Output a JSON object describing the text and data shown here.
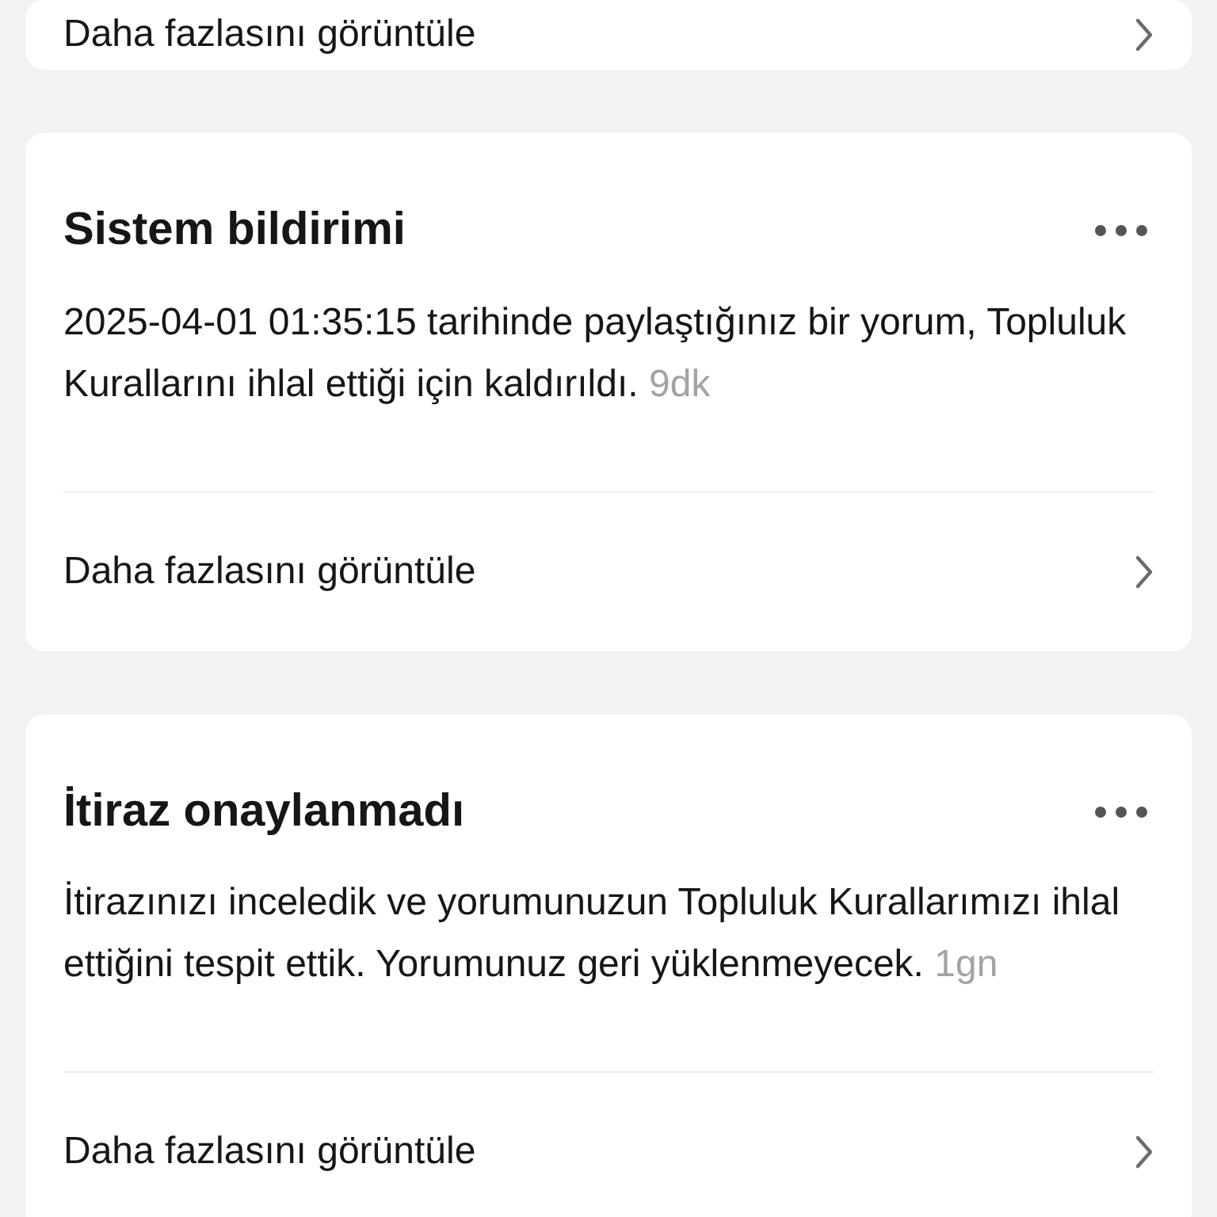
{
  "cards": [
    {
      "link": "Daha fazlasını görüntüle"
    },
    {
      "title": "Sistem bildirimi",
      "body": "2025-04-01 01:35:15 tarihinde paylaştığınız bir yorum, Topluluk Kurallarını ihlal ettiği için kaldırıldı.",
      "time": "9dk",
      "link": "Daha fazlasını görüntüle"
    },
    {
      "title": "İtiraz onaylanmadı",
      "body": "İtirazınızı inceledik ve yorumunuzun Topluluk Kurallarımızı ihlal ettiğini tespit ettik. Yorumunuz geri yüklenmeyecek.",
      "time": "1gn",
      "link": "Daha fazlasını görüntüle"
    }
  ]
}
